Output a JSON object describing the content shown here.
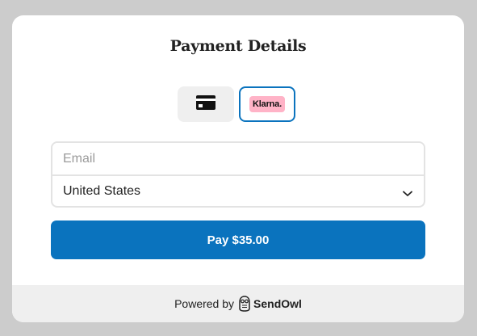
{
  "payment": {
    "title": "Payment Details",
    "methods": [
      {
        "icon": "credit-card-icon",
        "selected": false
      },
      {
        "label": "Klarna.",
        "selected": true
      }
    ],
    "email": {
      "placeholder": "Email",
      "value": ""
    },
    "country": {
      "value": "United States"
    },
    "pay_button": "Pay $35.00"
  },
  "footer": {
    "powered_by": "Powered by",
    "brand": "SendOwl",
    "brand_icon": "owl-icon"
  },
  "colors": {
    "accent": "#0a73be",
    "klarna_pink": "#ffb3c7",
    "background": "#cccccc",
    "footer_bg": "#efefef"
  }
}
